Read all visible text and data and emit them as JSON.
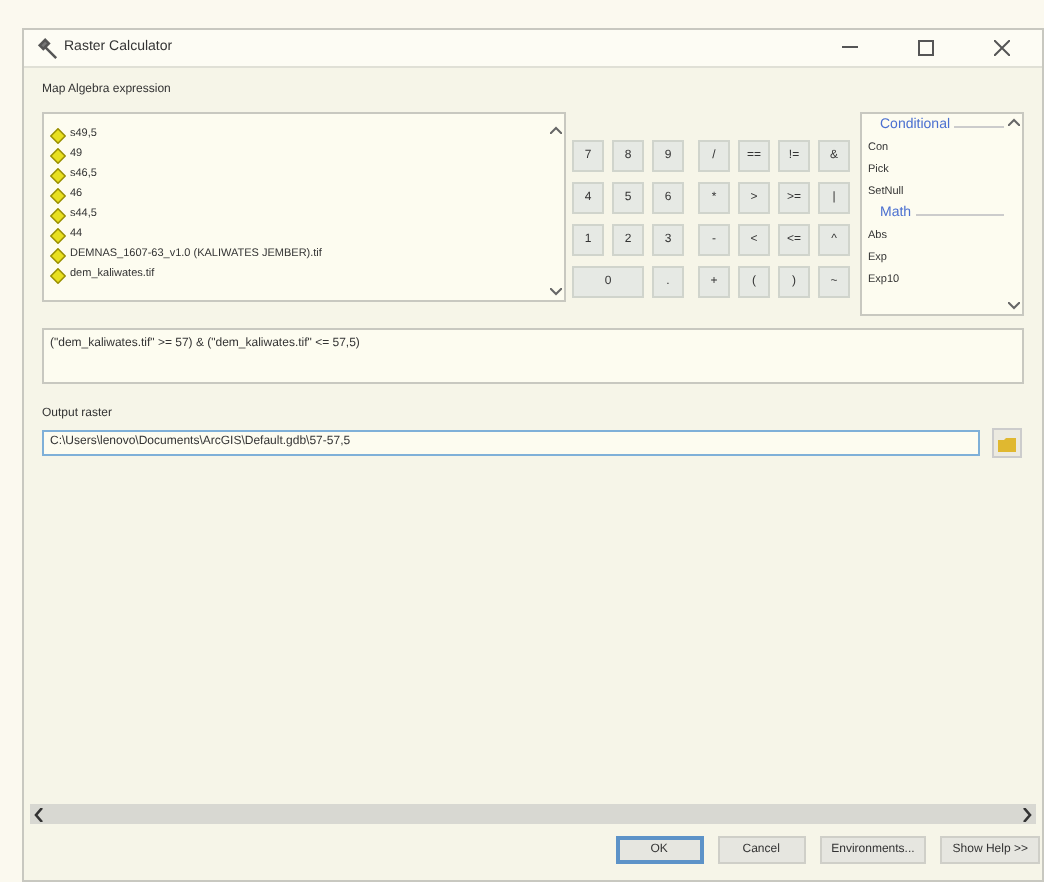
{
  "window": {
    "title": "Raster Calculator"
  },
  "expression_label": "Map Algebra expression",
  "layers": [
    "s49,5",
    "49",
    "s46,5",
    "46",
    "s44,5",
    "44",
    "DEMNAS_1607-63_v1.0 (KALIWATES JEMBER).tif",
    "dem_kaliwates.tif"
  ],
  "keypad": [
    [
      "7",
      "8",
      "9",
      "/",
      "==",
      "!=",
      "&"
    ],
    [
      "4",
      "5",
      "6",
      "*",
      ">",
      ">=",
      "|"
    ],
    [
      "1",
      "2",
      "3",
      "-",
      "<",
      "<=",
      "^"
    ],
    [
      "0",
      ".",
      "+",
      "(",
      ")",
      "~"
    ]
  ],
  "functions": [
    {
      "kind": "header",
      "label": "Conditional"
    },
    {
      "kind": "item",
      "label": "Con"
    },
    {
      "kind": "item",
      "label": "Pick"
    },
    {
      "kind": "item",
      "label": "SetNull"
    },
    {
      "kind": "header",
      "label": "Math"
    },
    {
      "kind": "item",
      "label": "Abs"
    },
    {
      "kind": "item",
      "label": "Exp"
    },
    {
      "kind": "item",
      "label": "Exp10"
    }
  ],
  "expression": "(\"dem_kaliwates.tif\" >= 57) & (\"dem_kaliwates.tif\" <= 57,5)",
  "output": {
    "label": "Output raster",
    "value": "C:\\Users\\lenovo\\Documents\\ArcGIS\\Default.gdb\\57-57,5"
  },
  "buttons": [
    {
      "label": "OK",
      "selected": true
    },
    {
      "label": "Cancel",
      "selected": false
    },
    {
      "label": "Environments...",
      "selected": false
    },
    {
      "label": "Show Help >>",
      "selected": false
    }
  ]
}
